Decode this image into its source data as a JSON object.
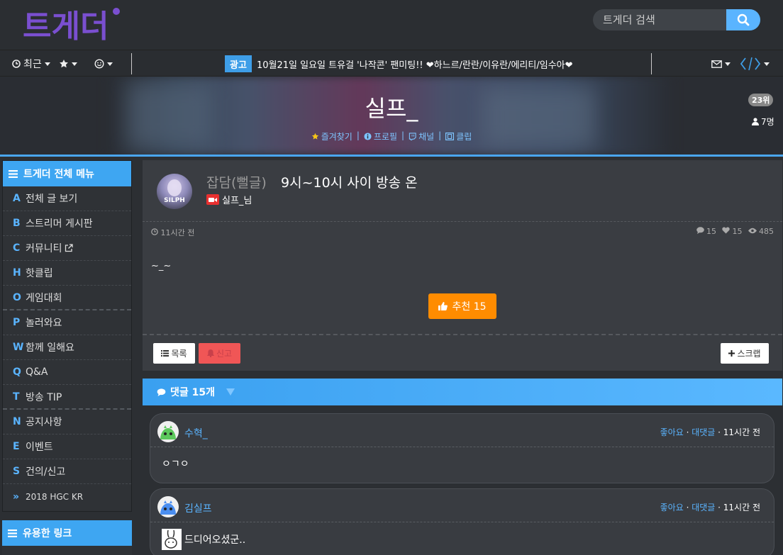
{
  "header": {
    "logo_text": "트게더",
    "search_placeholder": "트게더 검색"
  },
  "nav": {
    "recent_label": "최근",
    "ad_badge": "광고",
    "ad_text": "10월21일 일요일 트유걸 '나작콘' 팬미팅!! ❤하느르/란란/이유란/에리티/임수아❤"
  },
  "banner": {
    "streamer": "실프_",
    "links": [
      "즐겨찾기",
      "프로필",
      "채널",
      "클립"
    ],
    "rank": "23위",
    "viewers": "7명"
  },
  "sidebar": {
    "title": "트게더 전체 메뉴",
    "items": [
      {
        "key": "A",
        "label": "전체 글 보기"
      },
      {
        "key": "B",
        "label": "스트리머 게시판"
      },
      {
        "key": "C",
        "label": "커뮤니티"
      },
      {
        "key": "H",
        "label": "핫클립"
      },
      {
        "key": "O",
        "label": "게임대회"
      },
      {
        "key": "P",
        "label": "놀러와요"
      },
      {
        "key": "W",
        "label": "함께 일해요"
      },
      {
        "key": "Q",
        "label": "Q&A"
      },
      {
        "key": "T",
        "label": "방송 TIP"
      },
      {
        "key": "N",
        "label": "공지사항"
      },
      {
        "key": "E",
        "label": "이벤트"
      },
      {
        "key": "S",
        "label": "건의/신고"
      },
      {
        "key": "»",
        "label": "2018 HGC KR"
      }
    ],
    "links_title": "유용한 링크"
  },
  "post": {
    "category": "잡담(뻘글)",
    "title": "9시~10시 사이 방송 온",
    "author": "실프_님",
    "avatar_text": "SILPH",
    "time": "11시간 전",
    "comments": "15",
    "likes": "15",
    "views": "485",
    "body": "~_~",
    "recommend_label": "추천 15",
    "list_label": "목록",
    "report_label": "신고",
    "scrap_label": "스크랩"
  },
  "comments_header": "댓글 15개",
  "comments": [
    {
      "name": "수혁_",
      "like": "좋아요",
      "reply": "대댓글",
      "time": "11시간 전",
      "text": "ㅇㄱㅇ"
    },
    {
      "name": "김실프",
      "like": "좋아요",
      "reply": "대댓글",
      "time": "11시간 전",
      "text": "드디어오셨군.."
    }
  ],
  "colors": {
    "accent": "#3ea6f2",
    "logo": "#7a4fd0",
    "recommend": "#ff8c00",
    "report": "#f05656"
  }
}
